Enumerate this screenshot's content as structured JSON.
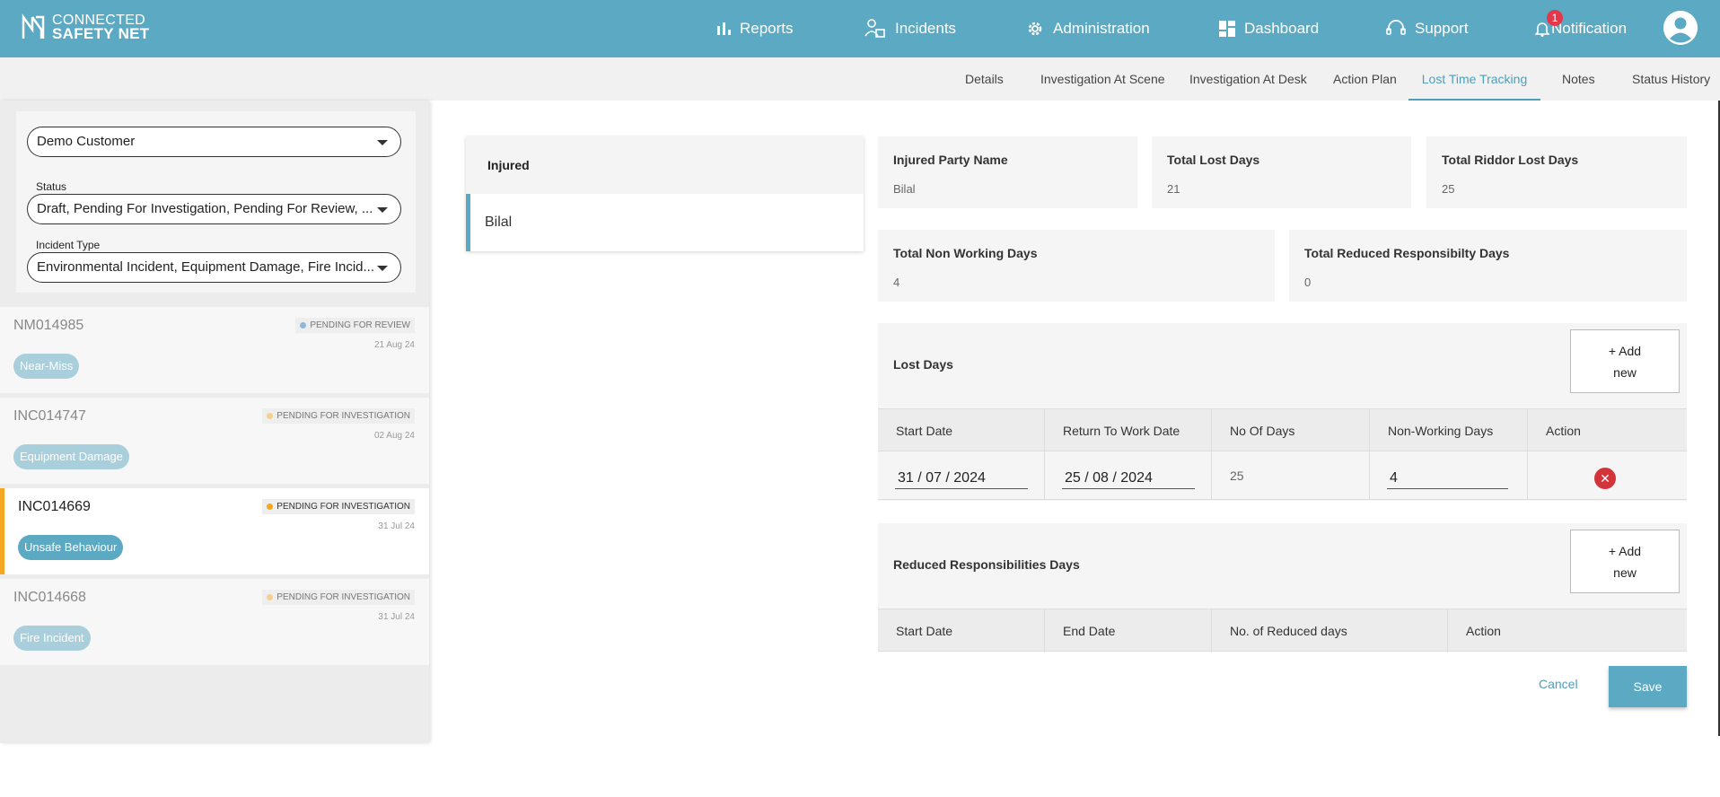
{
  "header": {
    "logo_line1": "CONNECTED",
    "logo_line2": "SAFETY NET",
    "nav": {
      "reports": "Reports",
      "incidents": "Incidents",
      "administration": "Administration",
      "dashboard": "Dashboard",
      "support": "Support",
      "notification": "Notification",
      "notification_count": "1"
    }
  },
  "tabs": [
    "Details",
    "Investigation At Scene",
    "Investigation At Desk",
    "Action Plan",
    "Lost Time Tracking",
    "Notes",
    "Status History"
  ],
  "active_tab": "Lost Time Tracking",
  "sidebar": {
    "customer": "Demo Customer",
    "status_label": "Status",
    "status_value": "Draft, Pending For Investigation, Pending For Review, ...",
    "type_label": "Incident Type",
    "type_value": "Environmental Incident, Equipment Damage, Fire Incid...",
    "incidents": [
      {
        "id": "NM014985",
        "status": "PENDING FOR REVIEW",
        "date": "21 Aug 24",
        "tag": "Near-Miss"
      },
      {
        "id": "INC014747",
        "status": "PENDING FOR INVESTIGATION",
        "date": "02 Aug 24",
        "tag": "Equipment Damage"
      },
      {
        "id": "INC014669",
        "status": "PENDING FOR INVESTIGATION",
        "date": "31 Jul 24",
        "tag": "Unsafe Behaviour"
      },
      {
        "id": "INC014668",
        "status": "PENDING FOR INVESTIGATION",
        "date": "31 Jul 24",
        "tag": "Fire Incident"
      }
    ]
  },
  "injured_panel": {
    "header": "Injured",
    "name": "Bilal"
  },
  "summary": {
    "injured_party_label": "Injured Party Name",
    "injured_party_value": "Bilal",
    "total_lost_label": "Total Lost Days",
    "total_lost_value": "21",
    "total_riddor_label": "Total Riddor Lost Days",
    "total_riddor_value": "25",
    "non_working_label": "Total Non Working Days",
    "non_working_value": "4",
    "reduced_label": "Total Reduced Responsibilty Days",
    "reduced_value": "0"
  },
  "lost_days": {
    "title": "Lost Days",
    "add_label_1": "+ Add",
    "add_label_2": "new",
    "columns": [
      "Start Date",
      "Return To Work Date",
      "No Of Days",
      "Non-Working Days",
      "Action"
    ],
    "row": {
      "start": "31 / 07 / 2024",
      "return": "25 / 08 / 2024",
      "days": "25",
      "non_working": "4"
    }
  },
  "reduced_days": {
    "title": "Reduced Responsibilities Days",
    "add_label_1": "+ Add",
    "add_label_2": "new",
    "columns": [
      "Start Date",
      "End Date",
      "No. of Reduced days",
      "Action"
    ]
  },
  "actions": {
    "cancel": "Cancel",
    "save": "Save"
  },
  "colors": {
    "brand": "#5ba9c2",
    "active_bar": "#f5a623",
    "review_dot": "#8fb8d9",
    "investigation_dot": "#f5a623",
    "delete": "#d3343a"
  }
}
